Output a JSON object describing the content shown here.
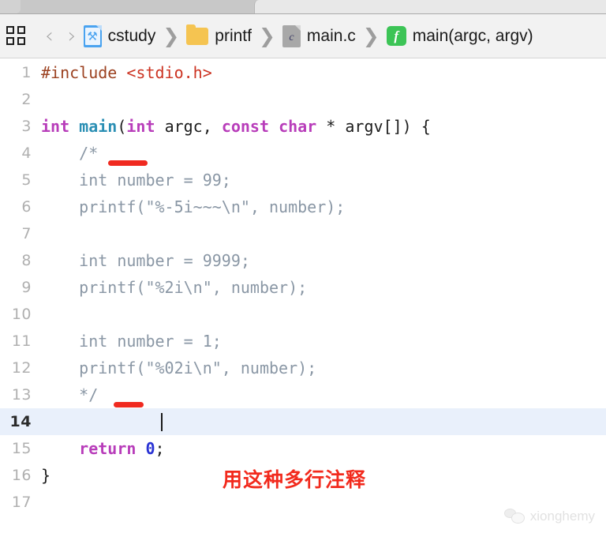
{
  "window": {
    "tabstrip": {
      "active_tab_label": "",
      "inactive_tab_label": ""
    }
  },
  "jumpbar": {
    "panel_toggle_icon": "grid-icon",
    "back_chevron": "‹",
    "forward_chevron": "›",
    "separator": "❯",
    "crumbs": [
      {
        "label": "cstudy",
        "icon": "xcode-project-icon",
        "glyph": "⚒"
      },
      {
        "label": "printf",
        "icon": "folder-icon",
        "glyph": ""
      },
      {
        "label": "main.c",
        "icon": "c-file-icon",
        "glyph": "c"
      },
      {
        "label": "main(argc, argv)",
        "icon": "function-icon",
        "glyph": "f"
      }
    ]
  },
  "editor": {
    "active_line": 14,
    "caret_line": 14,
    "lines": [
      {
        "n": "1",
        "tokens": [
          {
            "t": "#include ",
            "c": "t-pre"
          },
          {
            "t": "<stdio.h>",
            "c": "t-hdr"
          }
        ]
      },
      {
        "n": "2",
        "tokens": []
      },
      {
        "n": "3",
        "tokens": [
          {
            "t": "int ",
            "c": "t-kw"
          },
          {
            "t": "main",
            "c": "t-fn"
          },
          {
            "t": "(",
            "c": "t-plain"
          },
          {
            "t": "int ",
            "c": "t-kw"
          },
          {
            "t": "argc, ",
            "c": "t-plain"
          },
          {
            "t": "const ",
            "c": "t-kw"
          },
          {
            "t": "char ",
            "c": "t-kw"
          },
          {
            "t": "* argv[]) {",
            "c": "t-plain"
          }
        ]
      },
      {
        "n": "4",
        "tokens": [
          {
            "t": "    /*",
            "c": "t-cmt"
          }
        ]
      },
      {
        "n": "5",
        "tokens": [
          {
            "t": "    int number = 99;",
            "c": "t-cmt"
          }
        ]
      },
      {
        "n": "6",
        "tokens": [
          {
            "t": "    printf(\"%-5i~~~\\n\", number);",
            "c": "t-cmt"
          }
        ]
      },
      {
        "n": "7",
        "tokens": []
      },
      {
        "n": "8",
        "tokens": [
          {
            "t": "    int number = 9999;",
            "c": "t-cmt"
          }
        ]
      },
      {
        "n": "9",
        "tokens": [
          {
            "t": "    printf(\"%2i\\n\", number);",
            "c": "t-cmt"
          }
        ]
      },
      {
        "n": "10",
        "tokens": []
      },
      {
        "n": "11",
        "tokens": [
          {
            "t": "    int number = 1;",
            "c": "t-cmt"
          }
        ]
      },
      {
        "n": "12",
        "tokens": [
          {
            "t": "    printf(\"%02i\\n\", number);",
            "c": "t-cmt"
          }
        ]
      },
      {
        "n": "13",
        "tokens": [
          {
            "t": "    */",
            "c": "t-cmt"
          }
        ]
      },
      {
        "n": "14",
        "tokens": []
      },
      {
        "n": "15",
        "tokens": [
          {
            "t": "    return ",
            "c": "t-kw"
          },
          {
            "t": "0",
            "c": "t-num"
          },
          {
            "t": ";",
            "c": "t-plain"
          }
        ]
      },
      {
        "n": "16",
        "tokens": [
          {
            "t": "}",
            "c": "t-plain"
          }
        ]
      },
      {
        "n": "17",
        "tokens": []
      }
    ]
  },
  "annotations": {
    "note_text": "用这种多行注释",
    "note_color": "#f22a1d",
    "marker_color": "#f02a20",
    "marker_lines": [
      4,
      13
    ]
  },
  "watermark": {
    "text": "xionghemy",
    "icon": "wechat-icon"
  }
}
